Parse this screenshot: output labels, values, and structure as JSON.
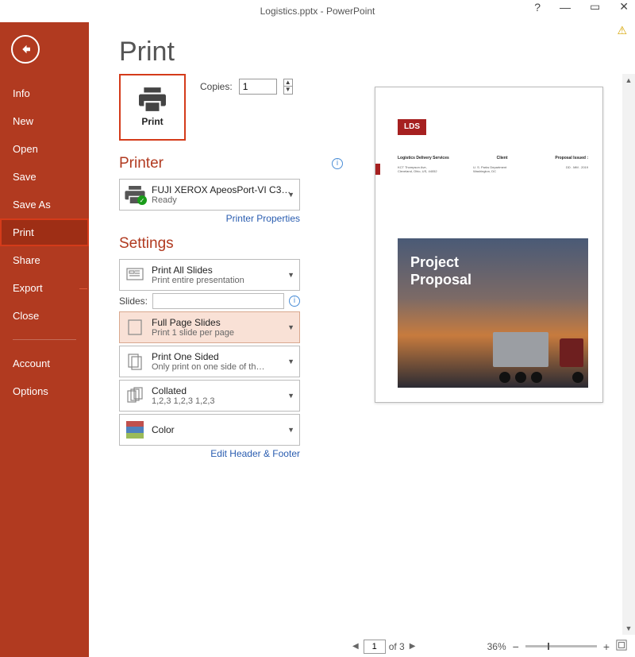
{
  "window": {
    "title": "Logistics.pptx - PowerPoint"
  },
  "sidebar": {
    "items": [
      {
        "label": "Info"
      },
      {
        "label": "New"
      },
      {
        "label": "Open"
      },
      {
        "label": "Save"
      },
      {
        "label": "Save As"
      },
      {
        "label": "Print"
      },
      {
        "label": "Share"
      },
      {
        "label": "Export"
      },
      {
        "label": "Close"
      }
    ],
    "account": "Account",
    "options": "Options"
  },
  "page": {
    "heading": "Print",
    "print_button": "Print",
    "copies_label": "Copies:",
    "copies_value": "1"
  },
  "printer": {
    "section": "Printer",
    "name": "FUJI XEROX ApeosPort-VI C3…",
    "status": "Ready",
    "properties_link": "Printer Properties"
  },
  "settings": {
    "section": "Settings",
    "scope": {
      "line1": "Print All Slides",
      "line2": "Print entire presentation"
    },
    "slides_label": "Slides:",
    "slides_value": "",
    "layout": {
      "line1": "Full Page Slides",
      "line2": "Print 1 slide per page"
    },
    "sides": {
      "line1": "Print One Sided",
      "line2": "Only print on one side of th…"
    },
    "collate": {
      "line1": "Collated",
      "line2": "1,2,3    1,2,3    1,2,3"
    },
    "color": {
      "line1": "Color"
    },
    "edit_hf": "Edit Header & Footer"
  },
  "preview": {
    "brand": "LDS",
    "col1_h": "Logistics Delivery Services",
    "col2_h": "Client",
    "col3_h": "Proposal Issued :",
    "col1_s": "KCT Thompson Ave,\nCleveland, Ohio, US, 44052",
    "col2_s": "U. S.  Parks Department\nWashington, DC",
    "col3_s": "DD . MM . 2019",
    "hero_line1": "Project",
    "hero_line2": "Proposal"
  },
  "footer": {
    "page": "1",
    "of_text": "of 3",
    "zoom": "36%"
  }
}
